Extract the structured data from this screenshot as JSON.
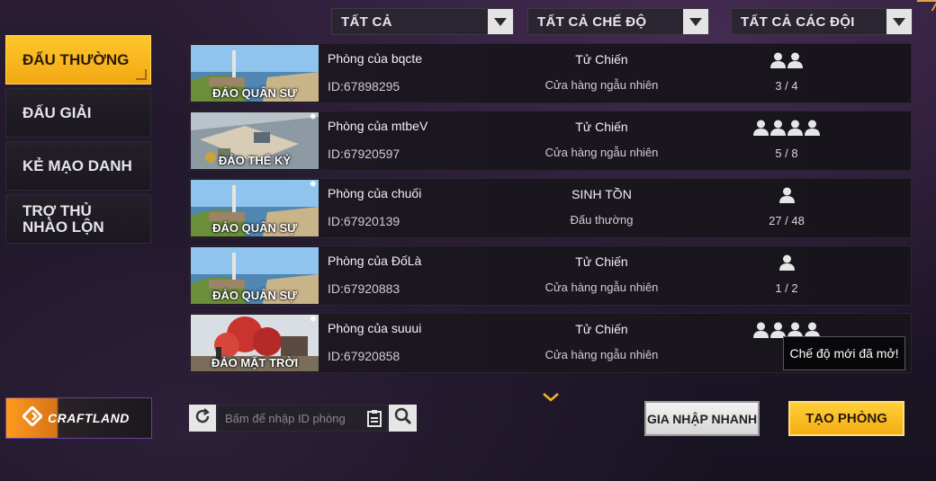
{
  "filters": [
    {
      "label": "TẤT CẢ"
    },
    {
      "label": "TẤT CẢ CHẾ ĐỘ"
    },
    {
      "label": "TẤT CẢ CÁC ĐỘI"
    }
  ],
  "sidebar": {
    "tabs": [
      {
        "label": "ĐẤU THƯỜNG",
        "active": true
      },
      {
        "label": "ĐẤU GIẢI",
        "active": false
      },
      {
        "label": "KẺ MẠO DANH",
        "active": false
      },
      {
        "label": "TRỢ THỦ NHÀO LỘN",
        "active": false
      }
    ],
    "craftland_label": "CRAFTLAND"
  },
  "rooms": [
    {
      "map": "ĐẢO QUÂN SỰ",
      "name": "Phòng của bqcte",
      "id": "ID:67898295",
      "mode": "Tử Chiến",
      "shop": "Cửa hàng ngẫu nhiên",
      "players": "3 / 4",
      "icons": 2,
      "badge": false
    },
    {
      "map": "ĐẢO THẾ KỶ",
      "name": "Phòng của mtbeV",
      "id": "ID:67920597",
      "mode": "Tử Chiến",
      "shop": "Cửa hàng ngẫu nhiên",
      "players": "5 / 8",
      "icons": 4,
      "badge": true
    },
    {
      "map": "ĐẢO QUÂN SỰ",
      "name": "Phòng của chuối",
      "id": "ID:67920139",
      "mode": "SINH TỒN",
      "shop": "Đấu thường",
      "players": "27 / 48",
      "icons": 1,
      "badge": true
    },
    {
      "map": "ĐẢO QUÂN SỰ",
      "name": "Phòng của ĐốLà",
      "id": "ID:67920883",
      "mode": "Tử Chiến",
      "shop": "Cửa hàng ngẫu nhiên",
      "players": "1 / 2",
      "icons": 1,
      "badge": false
    },
    {
      "map": "ĐẢO MẶT TRỜI",
      "name": "Phòng của suuui",
      "id": "ID:67920858",
      "mode": "Tử Chiến",
      "shop": "Cửa hàng ngẫu nhiên",
      "players": "4",
      "icons": 4,
      "badge": true
    }
  ],
  "tooltip": "Chế độ mới đã mở!",
  "search": {
    "placeholder": "Bấm để nhập ID phòng",
    "value": ""
  },
  "buttons": {
    "quick_join": "GIA NHẬP NHANH",
    "create_room": "TẠO PHÒNG"
  },
  "colors": {
    "accent": "#f5b51c",
    "panel": "#1d1822",
    "purple_border": "#6a3fa0"
  },
  "icons": {
    "dropdown": "chevron-down-icon",
    "player": "person-icon",
    "refresh": "refresh-icon",
    "paste": "clipboard-icon",
    "search": "search-icon",
    "craftland": "craftland-logo-icon",
    "scroll": "chevron-down-icon"
  }
}
